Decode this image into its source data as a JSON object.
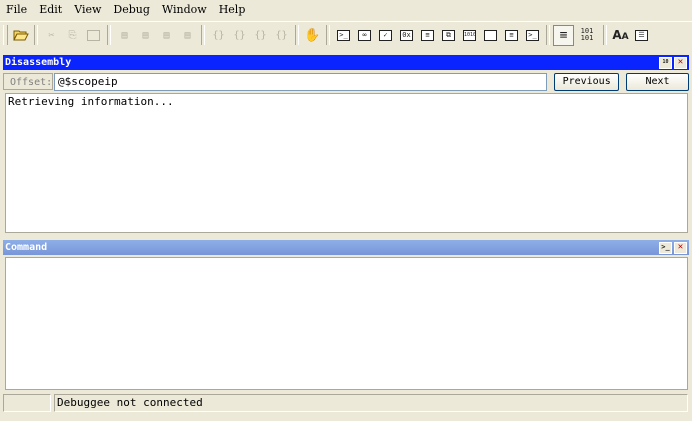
{
  "menu": [
    "File",
    "Edit",
    "View",
    "Debug",
    "Window",
    "Help"
  ],
  "toolbar": {
    "open_icon": "folder-open-icon",
    "glyphs": {
      "cut": "✂",
      "copy": "⎘",
      "paste": "📋",
      "step_a": "▤",
      "step_b": "▤",
      "step_c": "▤",
      "step_d": "▤",
      "brace_a": "{}",
      "brace_b": "{}",
      "brace_c": "{}",
      "brace_d": "{}",
      "hand": "✋",
      "cmd": ">_",
      "watch": "∞",
      "locals": "✓",
      "regs": "0x",
      "mem": "≡",
      "calls": "⧉",
      "disasm": "1010",
      "scratch": "",
      "proc": "≡",
      "cmdwin": ">_",
      "source_mode": "≡",
      "hex101": "101\n101",
      "font": "AA",
      "options": "☰"
    }
  },
  "disassembly": {
    "title": "Disassembly",
    "offset_label": "Offset:",
    "offset_value": "@$scopeip",
    "previous_label": "Previous",
    "next_label": "Next",
    "content": "Retrieving information..."
  },
  "command": {
    "title": "Command"
  },
  "status": {
    "left": "",
    "message": "Debuggee not connected"
  }
}
